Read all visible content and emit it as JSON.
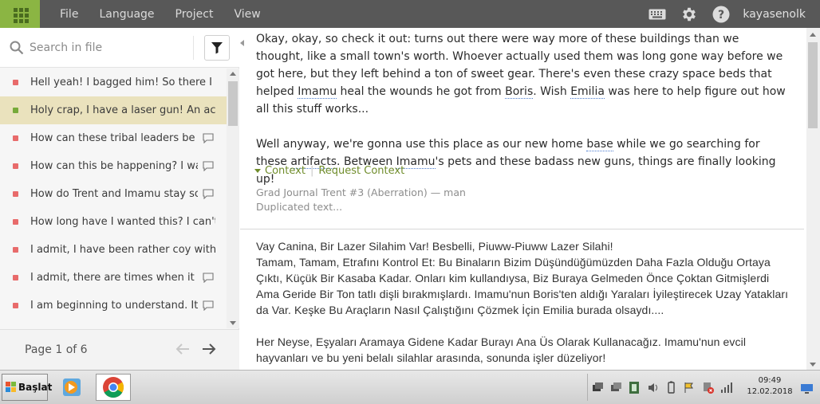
{
  "topbar": {
    "menu": [
      "File",
      "Language",
      "Project",
      "View"
    ],
    "user": "kayasenolk",
    "icons": [
      "apps-grid-icon",
      "keyboard-icon",
      "settings-gear-icon",
      "help-icon"
    ]
  },
  "sidebar": {
    "search_placeholder": "Search in file",
    "items": [
      {
        "text": "Hell yeah! I bagged him! So there I w...",
        "status": "red",
        "comment": false,
        "active": false
      },
      {
        "text": "Holy crap, I have a laser gun! An actu...",
        "status": "green",
        "comment": false,
        "active": true
      },
      {
        "text": "How can these tribal leaders be s...",
        "status": "red",
        "comment": true,
        "active": false
      },
      {
        "text": "How can this be happening? I wa...",
        "status": "red",
        "comment": true,
        "active": false
      },
      {
        "text": "How do Trent and Imamu stay so...",
        "status": "red",
        "comment": true,
        "active": false
      },
      {
        "text": "How long have I wanted this? I can't ...",
        "status": "red",
        "comment": false,
        "active": false
      },
      {
        "text": "I admit, I have been rather coy with ...",
        "status": "red",
        "comment": false,
        "active": false
      },
      {
        "text": "I admit, there are times when it i...",
        "status": "red",
        "comment": true,
        "active": false
      },
      {
        "text": "I am beginning to understand. It ...",
        "status": "red",
        "comment": true,
        "active": false
      }
    ],
    "pager": {
      "label": "Page 1 of 6"
    }
  },
  "main": {
    "source_p1": {
      "a": "Okay, okay, so check it out: turns out there were way more of these buildings than we thought, like a small town's worth. Whoever actually used them was long gone way before we got here, but they left behind a ton of sweet gear. There's even these crazy space beds that helped ",
      "k1": "Imamu",
      "b": " heal the wounds he got from ",
      "k2": "Boris",
      "c": ". Wish ",
      "k3": "Emilia",
      "d": " was here to help figure out how all this stuff works..."
    },
    "source_p2": {
      "a": "Well anyway, we're gonna use this place as our new home ",
      "k1": "base",
      "b": " while we go searching for these ",
      "k2": "artifacts",
      "c": ". Between ",
      "k3": "Imamu",
      "d": "'s pets and these badass new guns, things are finally looking up!"
    },
    "context_label": "Context",
    "request_context_label": "Request Context",
    "meta_line1": "Grad Journal Trent #3 (Aberration) — man",
    "meta_line2": "Duplicated text...",
    "translation_p1": "Vay Canina, Bir Lazer Silahim Var! Besbelli, Piuww-Piuww Lazer Silahi!\nTamam, Tamam, Etrafını Kontrol Et: Bu Binaların Bizim Düşündüğümüzden Daha Fazla Olduğu Ortaya Çıktı, Küçük Bir Kasaba Kadar. Onları kim kullandıysa, Biz Buraya Gelmeden Önce Çoktan Gitmişlerdi Ama Geride Bir Ton tatlı dişli bırakmışlardı. Imamu'nun Boris'ten aldığı Yaraları İyileştirecek Uzay Yatakları da Var. Keşke Bu Araçların Nasıl Çalıştığını Çözmek İçin Emilia burada olsaydı....",
    "translation_p2": "Her Neyse, Eşyaları Aramaya Gidene Kadar Burayı Ana Üs Olarak Kullanacağız. Imamu'nun evcil hayvanları ve bu yeni belalı silahlar arasında, sonunda işler düzeliyor!"
  },
  "taskbar": {
    "start_label": "Başlat",
    "time": "09:49",
    "date": "12.02.2018"
  }
}
